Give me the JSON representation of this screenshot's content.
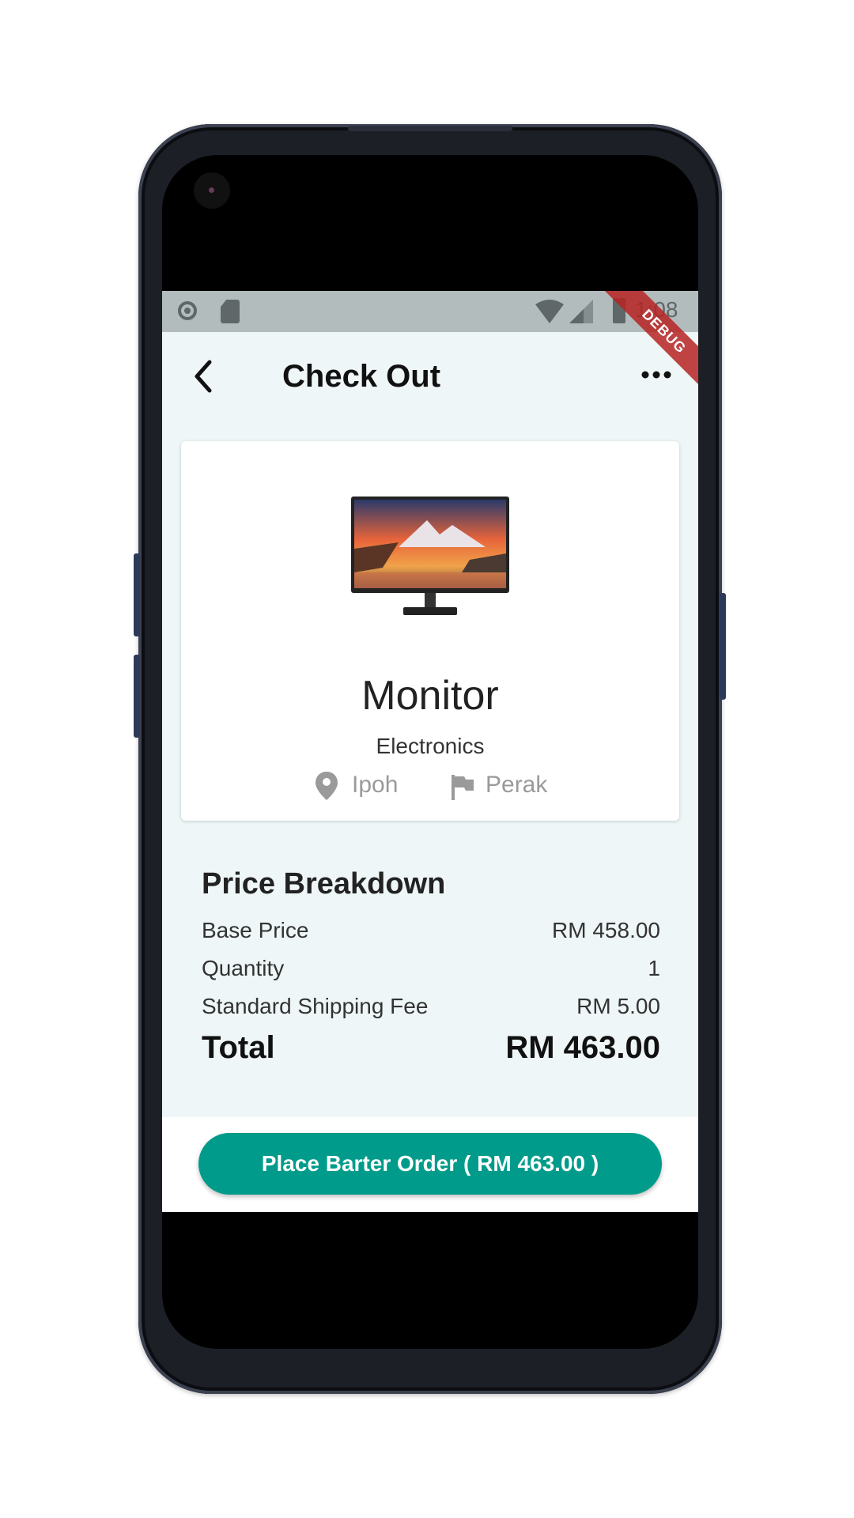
{
  "status_bar": {
    "time": "1:08",
    "debug_label": "DEBUG"
  },
  "app_bar": {
    "title": "Check Out"
  },
  "product": {
    "name": "Monitor",
    "category": "Electronics",
    "city": "Ipoh",
    "state": "Perak"
  },
  "breakdown": {
    "title": "Price Breakdown",
    "rows": [
      {
        "label": "Base Price",
        "value": "RM 458.00"
      },
      {
        "label": "Quantity",
        "value": "1"
      },
      {
        "label": "Standard Shipping Fee",
        "value": "RM 5.00"
      }
    ],
    "total_label": "Total",
    "total_value": "RM 463.00"
  },
  "footer": {
    "button_label": "Place Barter Order ( RM 463.00 )"
  },
  "colors": {
    "accent": "#009b8a",
    "background": "#eef6f7"
  }
}
